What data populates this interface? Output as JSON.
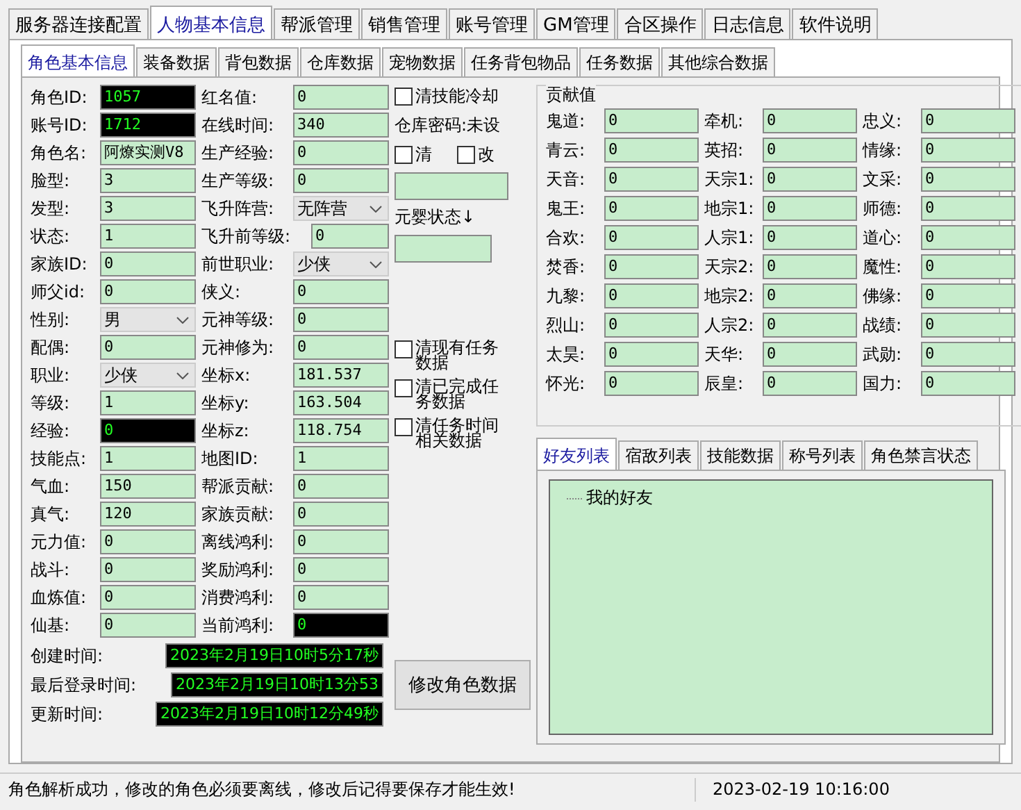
{
  "main_tabs": [
    {
      "label": "服务器连接配置",
      "selected": false
    },
    {
      "label": "人物基本信息",
      "selected": true
    },
    {
      "label": "帮派管理",
      "selected": false
    },
    {
      "label": "销售管理",
      "selected": false
    },
    {
      "label": "账号管理",
      "selected": false
    },
    {
      "label": "GM管理",
      "selected": false
    },
    {
      "label": "合区操作",
      "selected": false
    },
    {
      "label": "日志信息",
      "selected": false
    },
    {
      "label": "软件说明",
      "selected": false
    }
  ],
  "sub_tabs": [
    {
      "label": "角色基本信息",
      "selected": true
    },
    {
      "label": "装备数据",
      "selected": false
    },
    {
      "label": "背包数据",
      "selected": false
    },
    {
      "label": "仓库数据",
      "selected": false
    },
    {
      "label": "宠物数据",
      "selected": false
    },
    {
      "label": "任务背包物品",
      "selected": false
    },
    {
      "label": "任务数据",
      "selected": false
    },
    {
      "label": "其他综合数据",
      "selected": false
    }
  ],
  "fields_left": [
    {
      "label": "角色ID:",
      "kind": "dark",
      "value": "1057"
    },
    {
      "label": "账号ID:",
      "kind": "dark",
      "value": "1712"
    },
    {
      "label": "角色名:",
      "kind": "text",
      "value": "阿燎实测V8"
    },
    {
      "label": "脸型:",
      "kind": "text",
      "value": "3"
    },
    {
      "label": "发型:",
      "kind": "text",
      "value": "3"
    },
    {
      "label": "状态:",
      "kind": "text",
      "value": "1"
    },
    {
      "label": "家族ID:",
      "kind": "text",
      "value": "0"
    },
    {
      "label": "师父id:",
      "kind": "text",
      "value": "0"
    },
    {
      "label": "性别:",
      "kind": "select",
      "value": "男"
    },
    {
      "label": "配偶:",
      "kind": "text",
      "value": "0"
    },
    {
      "label": "职业:",
      "kind": "select",
      "value": "少侠"
    },
    {
      "label": "等级:",
      "kind": "text",
      "value": "1"
    },
    {
      "label": "经验:",
      "kind": "dark",
      "value": "0"
    },
    {
      "label": "技能点:",
      "kind": "text",
      "value": "1"
    },
    {
      "label": "气血:",
      "kind": "text",
      "value": "150"
    },
    {
      "label": "真气:",
      "kind": "text",
      "value": "120"
    },
    {
      "label": "元力值:",
      "kind": "text",
      "value": "0"
    },
    {
      "label": "战斗:",
      "kind": "text",
      "value": "0"
    },
    {
      "label": "血炼值:",
      "kind": "text",
      "value": "0"
    },
    {
      "label": "仙基:",
      "kind": "text",
      "value": "0"
    }
  ],
  "fields_mid": [
    {
      "label": "红名值:",
      "kind": "text",
      "value": "0"
    },
    {
      "label": "在线时间:",
      "kind": "text",
      "value": "340"
    },
    {
      "label": "生产经验:",
      "kind": "text",
      "value": "0"
    },
    {
      "label": "生产等级:",
      "kind": "text",
      "value": "0"
    },
    {
      "label": "飞升阵营:",
      "kind": "select",
      "value": "无阵营"
    },
    {
      "label": "飞升前等级:",
      "kind": "short",
      "value": "0"
    },
    {
      "label": "前世职业:",
      "kind": "select",
      "value": "少侠"
    },
    {
      "label": "侠义:",
      "kind": "text",
      "value": "0"
    },
    {
      "label": "元神等级:",
      "kind": "text",
      "value": "0"
    },
    {
      "label": "元神修为:",
      "kind": "text",
      "value": "0"
    },
    {
      "label": "坐标x:",
      "kind": "text",
      "value": "181.537"
    },
    {
      "label": "坐标y:",
      "kind": "text",
      "value": "163.504"
    },
    {
      "label": "坐标z:",
      "kind": "text",
      "value": "118.754"
    },
    {
      "label": "地图ID:",
      "kind": "text",
      "value": "1"
    },
    {
      "label": "帮派贡献:",
      "kind": "text",
      "value": "0"
    },
    {
      "label": "家族贡献:",
      "kind": "text",
      "value": "0"
    },
    {
      "label": "离线鸿利:",
      "kind": "text",
      "value": "0"
    },
    {
      "label": "奖励鸿利:",
      "kind": "text",
      "value": "0"
    },
    {
      "label": "消费鸿利:",
      "kind": "text",
      "value": "0"
    },
    {
      "label": "当前鸿利:",
      "kind": "dark",
      "value": "0"
    }
  ],
  "clear_cooldown": {
    "label": "清技能冷却",
    "checked": false
  },
  "warehouse_password": "仓库密码:未设",
  "password_options": [
    {
      "label": "清",
      "checked": false
    },
    {
      "label": "改",
      "checked": false
    }
  ],
  "yuanying_label": "元婴状态↓",
  "task_options": [
    {
      "label": "清现有任务数据",
      "checked": false
    },
    {
      "label": "清已完成任务数据",
      "checked": false
    },
    {
      "label": "清任务时间相关数据",
      "checked": false
    }
  ],
  "contribution": {
    "title": "贡献值",
    "columns": [
      [
        {
          "label": "鬼道:",
          "value": "0"
        },
        {
          "label": "青云:",
          "value": "0"
        },
        {
          "label": "天音:",
          "value": "0"
        },
        {
          "label": "鬼王:",
          "value": "0"
        },
        {
          "label": "合欢:",
          "value": "0"
        },
        {
          "label": "焚香:",
          "value": "0"
        },
        {
          "label": "九黎:",
          "value": "0"
        },
        {
          "label": "烈山:",
          "value": "0"
        },
        {
          "label": "太昊:",
          "value": "0"
        },
        {
          "label": "怀光:",
          "value": "0"
        }
      ],
      [
        {
          "label": "牵机:",
          "value": "0"
        },
        {
          "label": "英招:",
          "value": "0"
        },
        {
          "label": "天宗1:",
          "value": "0"
        },
        {
          "label": "地宗1:",
          "value": "0"
        },
        {
          "label": "人宗1:",
          "value": "0"
        },
        {
          "label": "天宗2:",
          "value": "0"
        },
        {
          "label": "地宗2:",
          "value": "0"
        },
        {
          "label": "人宗2:",
          "value": "0"
        },
        {
          "label": "天华:",
          "value": "0"
        },
        {
          "label": "辰皇:",
          "value": "0"
        }
      ],
      [
        {
          "label": "忠义:",
          "value": "0"
        },
        {
          "label": "情缘:",
          "value": "0"
        },
        {
          "label": "文采:",
          "value": "0"
        },
        {
          "label": "师德:",
          "value": "0"
        },
        {
          "label": "道心:",
          "value": "0"
        },
        {
          "label": "魔性:",
          "value": "0"
        },
        {
          "label": "佛缘:",
          "value": "0"
        },
        {
          "label": "战绩:",
          "value": "0"
        },
        {
          "label": "武勋:",
          "value": "0"
        },
        {
          "label": "国力:",
          "value": "0"
        }
      ]
    ]
  },
  "friend_tabs": [
    {
      "label": "好友列表",
      "selected": true
    },
    {
      "label": "宿敌列表",
      "selected": false
    },
    {
      "label": "技能数据",
      "selected": false
    },
    {
      "label": "称号列表",
      "selected": false
    },
    {
      "label": "角色禁言状态",
      "selected": false
    }
  ],
  "friend_tree": [
    {
      "label": "我的好友"
    }
  ],
  "times": [
    {
      "label": "创建时间:",
      "value": "2023年2月19日10时5分17秒"
    },
    {
      "label": "最后登录时间:",
      "value": "2023年2月19日10时13分53"
    },
    {
      "label": "更新时间:",
      "value": "2023年2月19日10时12分49秒"
    }
  ],
  "modify_button": "修改角色数据",
  "status_bar": {
    "message": "角色解析成功，修改的角色必须要离线，修改后记得要保存才能生效!",
    "time": "2023-02-19 10:16:00"
  }
}
